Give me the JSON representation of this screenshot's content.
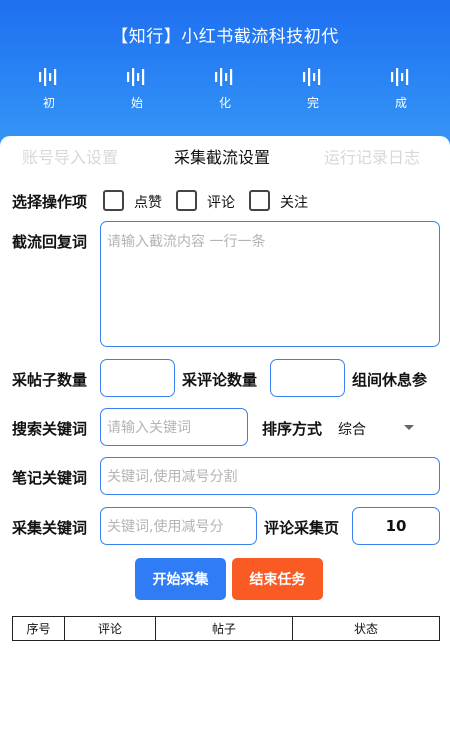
{
  "header": {
    "title": "【知行】小红书截流科技初代",
    "status_steps": [
      {
        "label": "初",
        "icon": "waveform-icon"
      },
      {
        "label": "始",
        "icon": "waveform-icon"
      },
      {
        "label": "化",
        "icon": "waveform-icon"
      },
      {
        "label": "完",
        "icon": "waveform-icon"
      },
      {
        "label": "成",
        "icon": "waveform-icon"
      }
    ]
  },
  "tabs": [
    {
      "label": "账号导入设置",
      "active": false
    },
    {
      "label": "采集截流设置",
      "active": true
    },
    {
      "label": "运行记录日志",
      "active": false
    }
  ],
  "form": {
    "operation_label": "选择操作项",
    "op_like": "点赞",
    "op_comment": "评论",
    "op_follow": "关注",
    "reply_label": "截流回复词",
    "reply_placeholder": "请输入截流内容 一行一条",
    "posts_count_label": "采帖子数量",
    "posts_count_value": "",
    "comments_count_label": "采评论数量",
    "comments_count_value": "",
    "group_rest_label": "组间休息参",
    "search_keyword_label": "搜索关键词",
    "search_keyword_placeholder": "请输入关键词",
    "sort_label": "排序方式",
    "sort_value": "综合",
    "note_keyword_label": "笔记关键词",
    "note_keyword_placeholder": "关键词,使用减号分割",
    "collect_keyword_label": "采集关键词",
    "collect_keyword_placeholder": "关键词,使用减号分",
    "comment_pages_label": "评论采集页",
    "comment_pages_value": "10"
  },
  "buttons": {
    "start": "开始采集",
    "stop": "结束任务"
  },
  "table": {
    "columns": [
      "序号",
      "评论",
      "帖子",
      "状态"
    ]
  },
  "colors": {
    "header_blue": "#1f6ff0",
    "input_border": "#3b80f0",
    "start_button": "#2f7cf6",
    "stop_button": "#fa5a24"
  }
}
